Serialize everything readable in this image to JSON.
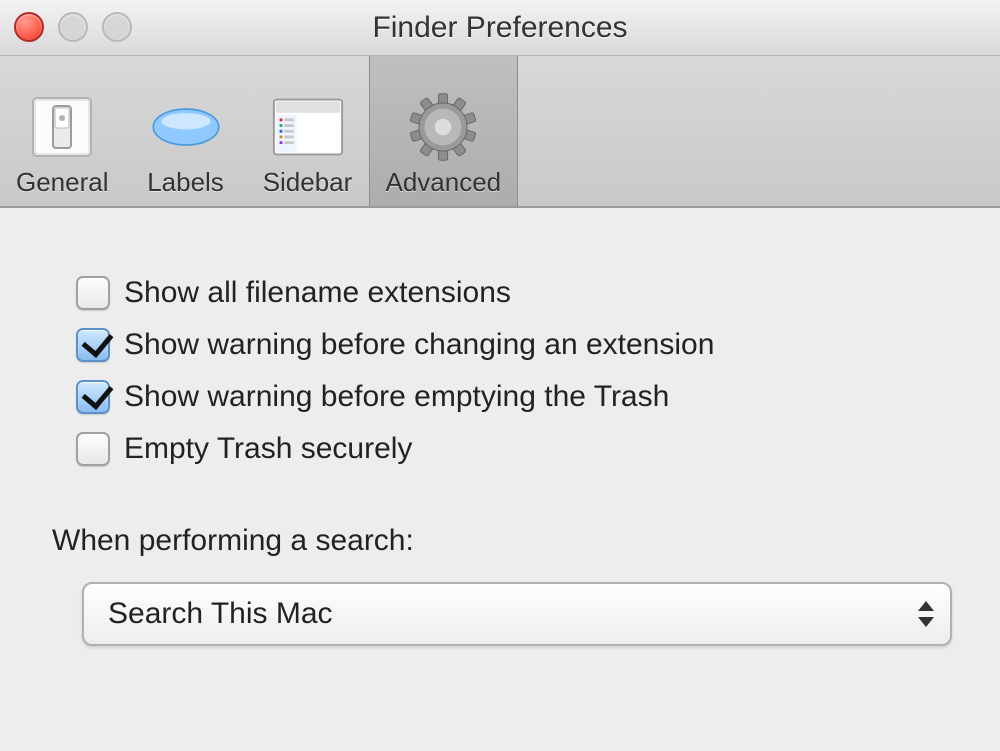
{
  "window": {
    "title": "Finder Preferences"
  },
  "toolbar": {
    "items": [
      {
        "label": "General"
      },
      {
        "label": "Labels"
      },
      {
        "label": "Sidebar"
      },
      {
        "label": "Advanced"
      }
    ],
    "selected_index": 3
  },
  "options": [
    {
      "label": "Show all filename extensions",
      "checked": false
    },
    {
      "label": "Show warning before changing an extension",
      "checked": true
    },
    {
      "label": "Show warning before emptying the Trash",
      "checked": true
    },
    {
      "label": "Empty Trash securely",
      "checked": false
    }
  ],
  "search": {
    "label": "When performing a search:",
    "selected": "Search This Mac"
  }
}
